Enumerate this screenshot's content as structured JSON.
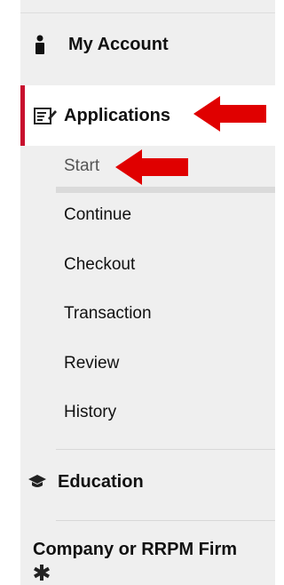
{
  "sidebar": {
    "my_account": {
      "label": "My Account",
      "icon": "person-icon"
    },
    "applications": {
      "label": "Applications",
      "icon": "edit-document-icon",
      "items": [
        "Start",
        "Continue",
        "Checkout",
        "Transaction",
        "Review",
        "History"
      ]
    },
    "education": {
      "label": "Education",
      "icon": "graduation-cap-icon"
    },
    "company": {
      "label": "Company or RRPM Firm",
      "icon": "asterisk-icon"
    }
  },
  "colors": {
    "accent": "#c8102e",
    "arrow": "#e00000",
    "panel_bg": "#efefef"
  }
}
